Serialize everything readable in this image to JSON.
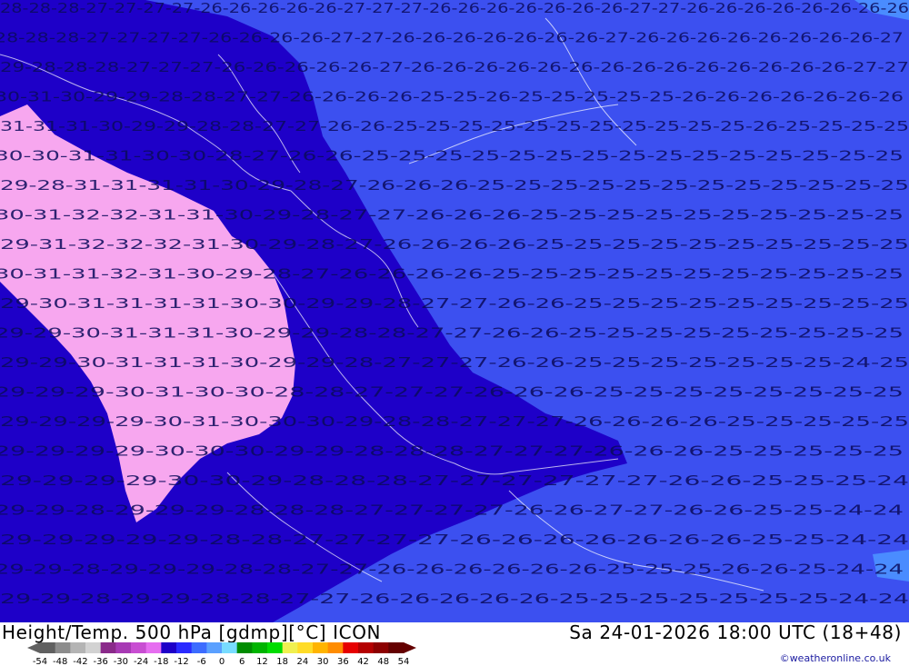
{
  "header": {
    "title": "Height/Temp. 500 hPa [gdmp][°C] ICON",
    "valid_time": "Sa 24-01-2026 18:00 UTC (18+48)",
    "credit": "©weatheronline.co.uk"
  },
  "legend": {
    "labels": [
      "-54",
      "-48",
      "-42",
      "-36",
      "-30",
      "-24",
      "-18",
      "-12",
      "-6",
      "0",
      "6",
      "12",
      "18",
      "24",
      "30",
      "36",
      "42",
      "48",
      "54"
    ],
    "colors": [
      "#606060",
      "#8c8c8c",
      "#b4b4b4",
      "#d2d2d2",
      "#8a2a8a",
      "#a73ab4",
      "#c84ed2",
      "#e66ef0",
      "#1e00c8",
      "#2a2aff",
      "#3c6cff",
      "#5aa0ff",
      "#78dcff",
      "#008c00",
      "#00b400",
      "#00dc00",
      "#f0f050",
      "#ffdc28",
      "#ffb400",
      "#ff8c00",
      "#e60000",
      "#b40000",
      "#8c0000",
      "#640000"
    ]
  },
  "map": {
    "fill_colors": {
      "cold_31_32": "#f7a7ef",
      "band_27_30": "#1e00c8",
      "band_25_26": "#3c50f0",
      "warm_24": "#4a8cff"
    },
    "contour_label_colors": {
      "band_27_30": "#c8c8ff",
      "band_25_26": "#0a0a5a"
    },
    "isotherm_labels": [
      {
        "text": "28-28-28-27-27-27-27-26-26-26-26-26-27-27-27-26-26-26-26-26-26-26-27-27-26-26-26-26-26-26-26-26"
      },
      {
        "text": "28-28-28-27-27-27-27-26-26-26-26-27-27-26-26-26-26-26-26-26-27-26-26-26-26-26-26-26-26-27"
      },
      {
        "text": "29-28-28-28-27-27-27-26-26-26-26-26-27-26-26-26-26-26-26-26-26-26-26-26-26-26-26-27-27"
      },
      {
        "text": "30-31-30-29-29-28-28-27-27-26-26-26-26-25-25-26-25-25-25-25-25-26-26-26-26-26-26-26"
      },
      {
        "text": "31-31-31-30-29-29-28-28-27-27-26-26-25-25-25-25-25-25-25-25-25-25-25-26-25-25-25-25"
      },
      {
        "text": "30-30-31-31-30-30-28-27-26-26-25-25-25-25-25-25-25-25-25-25-25-25-25-25-25"
      },
      {
        "text": "29-28-31-31-31-31-30-29-28-27-26-26-26-25-25-25-25-25-25-25-25-25-25-25-25"
      },
      {
        "text": "30-31-32-32-31-31-30-29-28-27-27-26-26-26-25-25-25-25-25-25-25-25-25-25"
      },
      {
        "text": "29-31-32-32-32-31-30-29-28-27-26-26-26-26-25-25-25-25-25-25-25-25-25-25"
      },
      {
        "text": "30-31-31-32-31-30-29-28-27-26-26-26-26-25-25-25-25-25-25-25-25-25-25-25"
      },
      {
        "text": "29-30-31-31-31-31-30-30-29-29-28-27-27-26-26-25-25-25-25-25-25-25-25-25"
      },
      {
        "text": "29-29-30-31-31-31-30-29-29-28-28-27-27-26-26-25-25-25-25-25-25-25-25-25"
      },
      {
        "text": "29-29-30-31-31-31-30-29-29-28-27-27-27-26-26-25-25-25-25-25-25-25-24-25"
      },
      {
        "text": "29-29-29-30-31-30-30-28-28-27-27-27-26-26-26-25-25-25-25-25-25-25-25"
      },
      {
        "text": "29-29-29-29-30-31-30-30-30-29-28-28-27-27-27-26-26-26-26-25-25-25-25-25"
      },
      {
        "text": "29-29-29-29-30-30-30-29-29-28-28-28-27-27-27-26-26-26-25-25-25-25-25"
      },
      {
        "text": "29-29-29-29-30-30-29-28-28-28-27-27-27-27-27-27-26-26-25-25-25-24"
      },
      {
        "text": "29-29-28-29-29-29-28-28-28-27-27-27-27-26-26-27-27-26-26-25-25-24-24"
      },
      {
        "text": "29-29-29-29-29-28-28-27-27-27-27-26-26-26-26-26-26-26-25-25-24-24"
      },
      {
        "text": "29-29-28-29-29-29-28-28-27-27-26-26-26-26-26-26-25-25-25-26-26-25-24-24"
      },
      {
        "text": "29-29-28-29-29-28-28-27-27-26-26-26-26-26-25-25-25-25-25-25-25-24-24"
      }
    ]
  }
}
